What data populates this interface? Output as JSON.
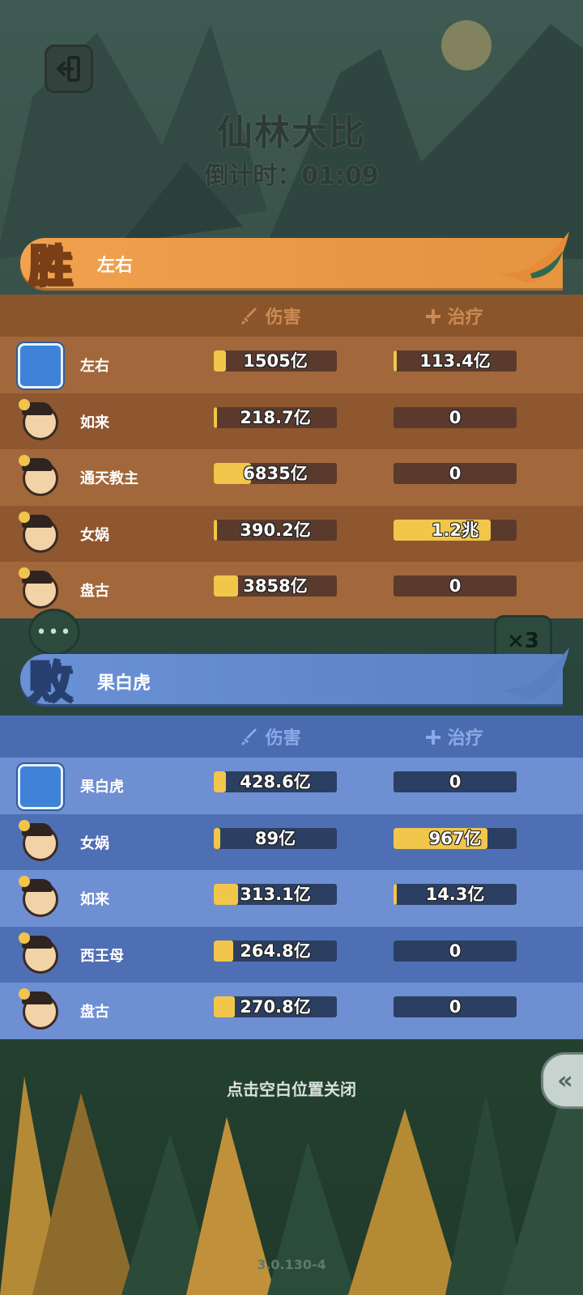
{
  "header": {
    "title": "仙林大比",
    "countdown_label": "倒计时：",
    "countdown_time": "01:09"
  },
  "columns": {
    "damage": "伤害",
    "heal": "治疗"
  },
  "winner": {
    "badge": "胜",
    "team_name": "左右",
    "rows": [
      {
        "name": "左右",
        "damage": "1505亿",
        "damage_frac": 0.1,
        "heal": "113.4亿",
        "heal_frac": 0.01,
        "avatar_icon": "player-avatar-icon"
      },
      {
        "name": "如来",
        "damage": "218.7亿",
        "damage_frac": 0.01,
        "heal": "0",
        "heal_frac": 0,
        "avatar_icon": "rulai-avatar-icon"
      },
      {
        "name": "通天教主",
        "damage": "6835亿",
        "damage_frac": 0.3,
        "heal": "0",
        "heal_frac": 0,
        "avatar_icon": "tongtian-avatar-icon"
      },
      {
        "name": "女娲",
        "damage": "390.2亿",
        "damage_frac": 0.02,
        "heal": "1.2兆",
        "heal_frac": 0.79,
        "avatar_icon": "nuwa-avatar-icon"
      },
      {
        "name": "盘古",
        "damage": "3858亿",
        "damage_frac": 0.2,
        "heal": "0",
        "heal_frac": 0,
        "avatar_icon": "pangu-avatar-icon"
      }
    ]
  },
  "loser": {
    "badge": "败",
    "team_name": "果白虎",
    "rows": [
      {
        "name": "果白虎",
        "damage": "428.6亿",
        "damage_frac": 0.1,
        "heal": "0",
        "heal_frac": 0,
        "avatar_icon": "player-avatar-icon"
      },
      {
        "name": "女娲",
        "damage": "89亿",
        "damage_frac": 0.05,
        "heal": "967亿",
        "heal_frac": 0.76,
        "avatar_icon": "nuwa-avatar-icon"
      },
      {
        "name": "如来",
        "damage": "313.1亿",
        "damage_frac": 0.2,
        "heal": "14.3亿",
        "heal_frac": 0.01,
        "avatar_icon": "rulai-avatar-icon"
      },
      {
        "name": "西王母",
        "damage": "264.8亿",
        "damage_frac": 0.16,
        "heal": "0",
        "heal_frac": 0,
        "avatar_icon": "xiwangmu-avatar-icon"
      },
      {
        "name": "盘古",
        "damage": "270.8亿",
        "damage_frac": 0.17,
        "heal": "0",
        "heal_frac": 0,
        "avatar_icon": "pangu-avatar-icon"
      }
    ]
  },
  "speed_label": "×3",
  "close_hint": "点击空白位置关闭",
  "version": "3.0.130-4",
  "colors": {
    "win_banner": "#e79746",
    "lose_banner": "#5f86c9",
    "bar_fill": "#f1c64a"
  }
}
